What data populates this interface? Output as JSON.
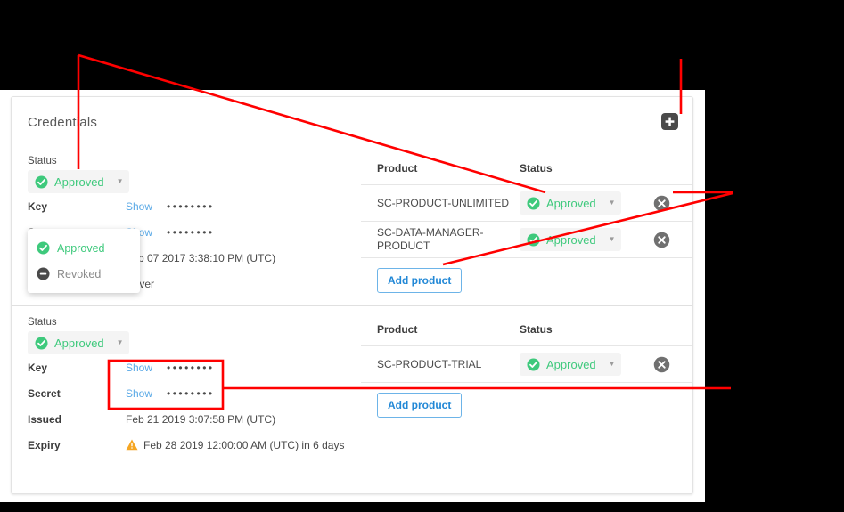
{
  "card": {
    "title": "Credentials",
    "add_icon": "plus-square-icon"
  },
  "labels": {
    "status": "Status",
    "key": "Key",
    "secret": "Secret",
    "issued": "Issued",
    "expiry": "Expiry",
    "product_col": "Product",
    "status_col": "Status",
    "show": "Show",
    "add_product": "Add product",
    "masked_value": "••••••••"
  },
  "colors": {
    "approved_green": "#3ec97c",
    "link_blue": "#5aa9e6",
    "button_blue": "#2288d6",
    "warning_orange": "#f5a623",
    "annotation_red": "#ff0000",
    "delete_grey": "#707070",
    "add_icon_dark": "#4a4a4a"
  },
  "status_dropdown": {
    "open": true,
    "selected": "Approved",
    "options": [
      {
        "label": "Approved",
        "icon": "check-circle-icon",
        "state": "approved"
      },
      {
        "label": "Revoked",
        "icon": "minus-circle-icon",
        "state": "revoked"
      }
    ]
  },
  "credentials": [
    {
      "status": "Approved",
      "key": {
        "show": "Show",
        "value": "••••••••"
      },
      "secret": {
        "show": "Show",
        "value": "••••••••"
      },
      "issued": "Feb 07 2017 3:38:10 PM (UTC)",
      "expiry": "Never",
      "expiry_warning": false,
      "products": [
        {
          "name": "SC-PRODUCT-UNLIMITED",
          "status": "Approved"
        },
        {
          "name": "SC-DATA-MANAGER-PRODUCT",
          "status": "Approved"
        }
      ],
      "add_product": "Add product"
    },
    {
      "status": "Approved",
      "key": {
        "show": "Show",
        "value": "••••••••"
      },
      "secret": {
        "show": "Show",
        "value": "••••••••"
      },
      "issued": "Feb 21 2019 3:07:58 PM (UTC)",
      "expiry": "Feb 28 2019 12:00:00 AM (UTC) in 6 days",
      "expiry_warning": true,
      "products": [
        {
          "name": "SC-PRODUCT-TRIAL",
          "status": "Approved"
        }
      ],
      "add_product": "Add product"
    }
  ]
}
